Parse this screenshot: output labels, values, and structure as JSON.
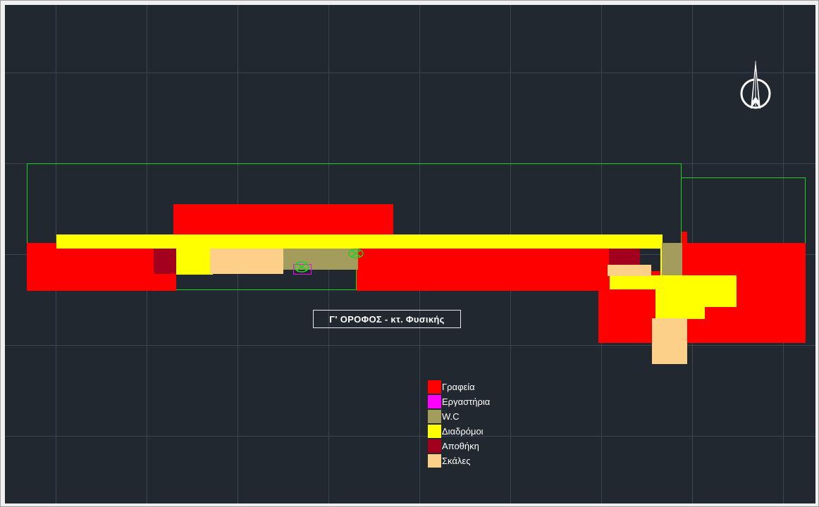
{
  "drawing": {
    "floor_title": "Γ' ΟΡΟΦΟΣ - κτ. Φυσικής"
  },
  "legend": {
    "items": [
      {
        "label": "Γραφεία",
        "color": "#ff0000"
      },
      {
        "label": "Εργαστήρια",
        "color": "#ff00ff"
      },
      {
        "label": "W.C",
        "color": "#a39c5d"
      },
      {
        "label": "Διαδρόμοι",
        "color": "#ffff00"
      },
      {
        "label": "Αποθήκη",
        "color": "#a3001e"
      },
      {
        "label": "Σκάλες",
        "color": "#fcd089"
      }
    ]
  },
  "colors": {
    "background": "#212830",
    "grid": "#3a4454",
    "outline": "#1fd11f"
  },
  "icons": {
    "north_arrow": "north-arrow-icon",
    "wc_symbol": "wc-symbol-icon"
  }
}
